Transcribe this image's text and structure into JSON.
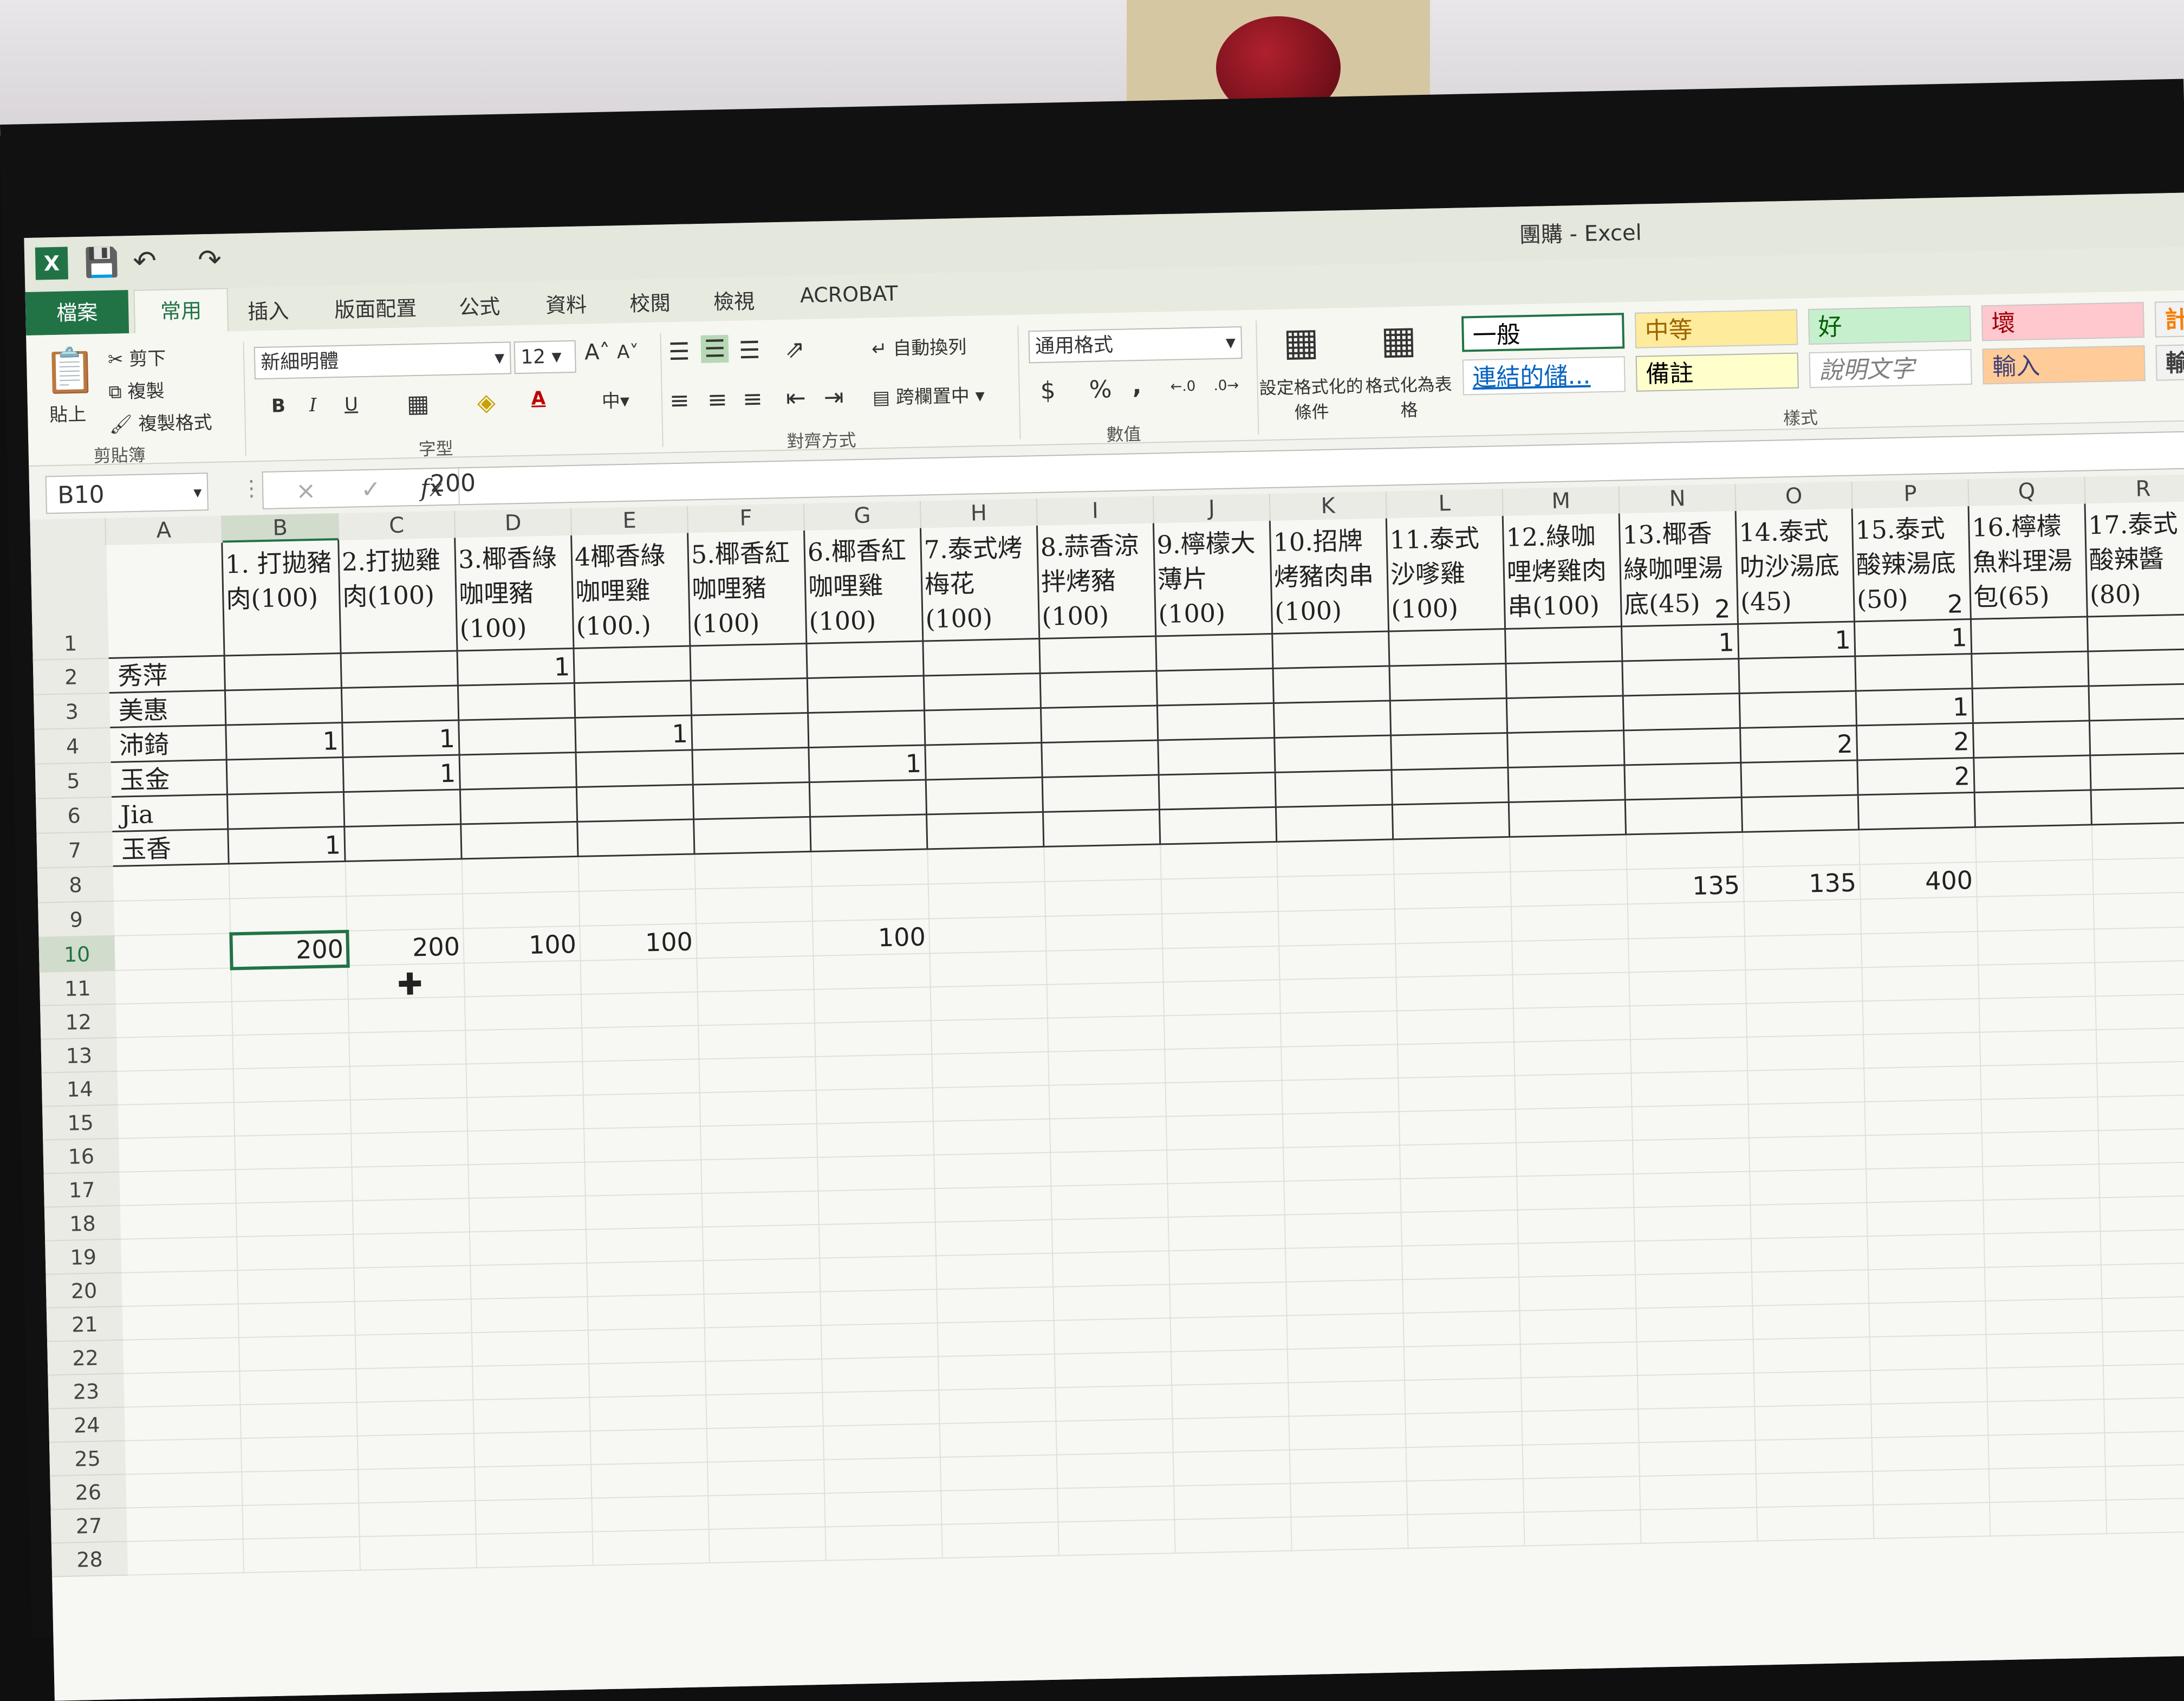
{
  "window": {
    "title": "團購 - Excel",
    "app_icon": "X"
  },
  "quick_access": {
    "save_icon": "save-icon",
    "undo_icon": "undo-icon",
    "redo_icon": "redo-icon"
  },
  "tabs": [
    "檔案",
    "常用",
    "插入",
    "版面配置",
    "公式",
    "資料",
    "校閱",
    "檢視",
    "ACROBAT"
  ],
  "ribbon": {
    "clipboard": {
      "paste": "貼上",
      "cut": "剪下",
      "copy": "複製",
      "format_painter": "複製格式",
      "group": "剪貼簿"
    },
    "font": {
      "name": "新細明體",
      "size": "12",
      "bold": "B",
      "italic": "I",
      "underline": "U",
      "font_color": "A",
      "group": "字型"
    },
    "alignment": {
      "wrap_text": "自動換列",
      "merge_center": "跨欄置中",
      "group": "對齊方式"
    },
    "number": {
      "format": "通用格式",
      "currency": "$",
      "percent": "%",
      "comma": ",",
      "group": "數值"
    },
    "styles": {
      "conditional": "設定格式化的條件",
      "as_table": "格式化為表格",
      "cells": [
        "一般",
        "中等",
        "好",
        "壞",
        "計算方式",
        "連結的儲...",
        "備註",
        "說明文字",
        "輸入",
        "輸出"
      ],
      "group": "樣式"
    }
  },
  "formula_bar": {
    "name_box": "B10",
    "cancel": "×",
    "enter": "✓",
    "fx": "fx",
    "content": "200"
  },
  "columns": [
    "A",
    "B",
    "C",
    "D",
    "E",
    "F",
    "G",
    "H",
    "I",
    "J",
    "K",
    "L",
    "M",
    "N",
    "O",
    "P",
    "Q",
    "R"
  ],
  "rows": [
    "1",
    "2",
    "3",
    "4",
    "5",
    "6",
    "7",
    "8",
    "9",
    "10",
    "11",
    "12",
    "13",
    "14",
    "15",
    "16",
    "17",
    "18",
    "19",
    "20",
    "21",
    "22",
    "23",
    "24",
    "25",
    "26",
    "27",
    "28"
  ],
  "table_headers": [
    "",
    "1. 打拋豬肉(100)",
    "2.打拋雞肉(100)",
    "3.椰香綠咖哩豬(100)",
    "4椰香綠咖哩雞(100.)",
    "5.椰香紅咖哩豬(100)",
    "6.椰香紅咖哩雞(100)",
    "7.泰式烤梅花(100)",
    "8.蒜香涼拌烤豬(100)",
    "9.檸檬大薄片(100)",
    "10.招牌烤豬肉串(100)",
    "11.泰式沙嗲雞(100)",
    "12.綠咖哩烤雞肉串(100)",
    "13.椰香綠咖哩湯底(45)",
    "14.泰式叻沙湯底(45)",
    "15.泰式酸辣湯底(50)",
    "16.檸檬魚料理湯包(65)",
    "17.泰式酸辣醬(80)"
  ],
  "row1_values": {
    "N": "2",
    "P": "2"
  },
  "people": [
    {
      "name": "秀萍",
      "values": {
        "D": "1",
        "N": "1",
        "O": "1",
        "P": "1"
      }
    },
    {
      "name": "美惠",
      "values": {}
    },
    {
      "name": "沛錡",
      "values": {
        "B": "1",
        "C": "1",
        "E": "1",
        "P": "1"
      }
    },
    {
      "name": "玉金",
      "values": {
        "C": "1",
        "G": "1",
        "O": "2",
        "P": "2"
      }
    },
    {
      "name": "Jia",
      "values": {
        "P": "2"
      }
    },
    {
      "name": "玉香",
      "values": {
        "B": "1"
      }
    }
  ],
  "totals_row9": {
    "N": "135",
    "O": "135",
    "P": "400"
  },
  "totals_row10": {
    "B": "200",
    "C": "200",
    "D": "100",
    "E": "100",
    "G": "100"
  },
  "colors": {
    "excel_green": "#217346",
    "neutral_bg": "#ffeb9c",
    "good_bg": "#c6efce",
    "bad_bg": "#ffc7ce",
    "input_bg": "#ffcc99",
    "calc_text": "#fa7d00"
  }
}
